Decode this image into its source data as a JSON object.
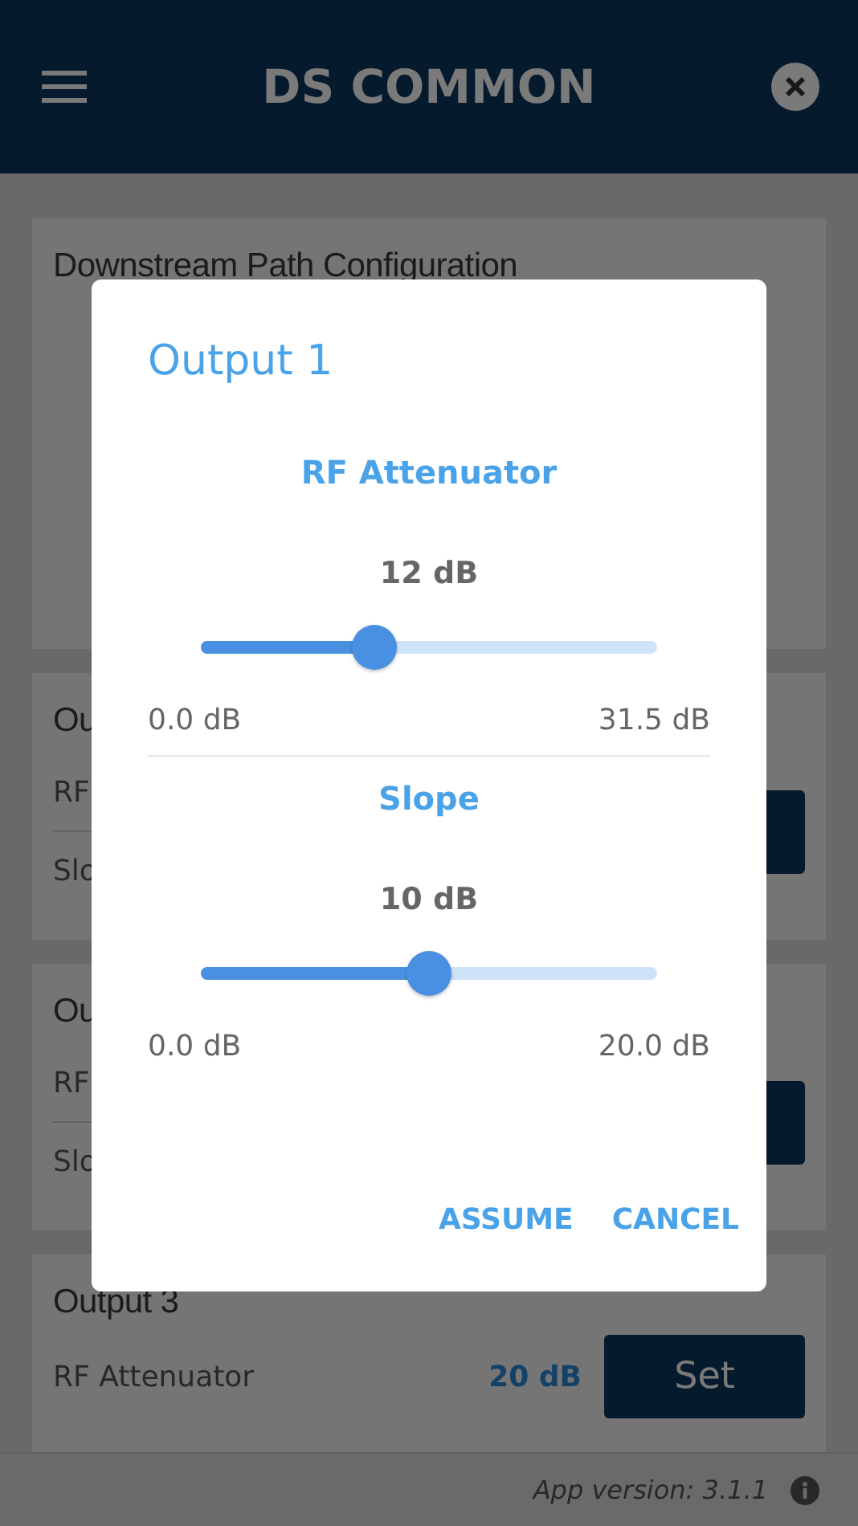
{
  "header": {
    "title": "DS COMMON"
  },
  "cards": [
    {
      "title": "Downstream Path Configuration",
      "kind": "config"
    },
    {
      "title": "Ou",
      "kind": "output",
      "set_button": true,
      "rows": [
        {
          "label": "RF"
        },
        {
          "label": "Slo"
        }
      ]
    },
    {
      "title": "Ou",
      "kind": "output",
      "set_button": true,
      "rows": [
        {
          "label": "RF"
        },
        {
          "label": "Slo"
        }
      ]
    },
    {
      "title": "Output 3",
      "kind": "output",
      "set_button": true,
      "set_label": "Set",
      "rows": [
        {
          "label": "RF Attenuator",
          "value": "20 dB"
        }
      ]
    }
  ],
  "footer": {
    "version": "App version: 3.1.1"
  },
  "dialog": {
    "title": "Output 1",
    "sections": [
      {
        "heading": "RF Attenuator",
        "reading": "12 dB",
        "level": 0.381,
        "min": "0.0 dB",
        "max": "31.5 dB"
      },
      {
        "heading": "Slope",
        "reading": "10 dB",
        "level": 0.5,
        "min": "0.0 dB",
        "max": "20.0 dB"
      }
    ],
    "buttons": [
      "ASSUME",
      "CANCEL"
    ]
  }
}
